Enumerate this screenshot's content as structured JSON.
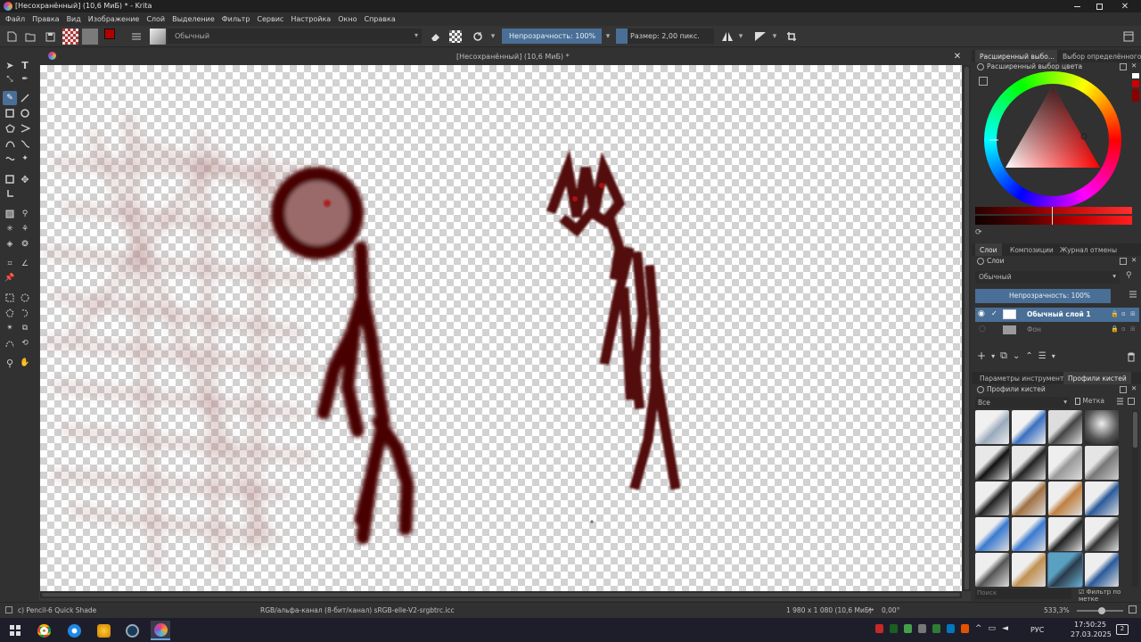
{
  "window": {
    "title": "[Несохранённый]  (10,6 МиБ) * - Krita",
    "doc_title": "[Несохранённый]  (10,6 МиБ) *"
  },
  "menu": [
    "Файл",
    "Правка",
    "Вид",
    "Изображение",
    "Слой",
    "Выделение",
    "Фильтр",
    "Сервис",
    "Настройка",
    "Окно",
    "Справка"
  ],
  "toolbar": {
    "blend_mode": "Обычный",
    "opacity_label": "Непрозрачность: 100%",
    "size_label": "Размер: 2,00 пикс."
  },
  "dock_top": {
    "tabs": [
      "Расширенный выбо...",
      "Выбор определённого..."
    ],
    "header": "Расширенный выбор цвета"
  },
  "layers_dock": {
    "tabs": [
      "Слои",
      "Композиции",
      "Журнал отмены"
    ],
    "header": "Слои",
    "blend_mode": "Обычный",
    "opacity": "Непрозрачность: 100%",
    "layers": [
      {
        "name": "Обычный слой 1",
        "selected": true
      },
      {
        "name": "Фон",
        "selected": false
      }
    ]
  },
  "brush_dock": {
    "tabs": [
      "Параметры инструмента",
      "Профили кистей"
    ],
    "header": "Профили кистей",
    "filter_all": "Все",
    "tag_label": "Метка",
    "search_placeholder": "Поиск",
    "filter_by_tag": "Фильтр по метке"
  },
  "status": {
    "brush_name": "c) Pencil-6 Quick Shade",
    "color_space": "RGB/альфа-канал (8-бит/канал)  sRGB-elle-V2-srgbtrc.icc",
    "image_size": "1 980 x 1 080 (10,6 МиБ)",
    "rotation": "0,00°",
    "zoom": "533,3%"
  },
  "taskbar": {
    "lang": "РУС",
    "time": "17:50:25",
    "date": "27.03.2025",
    "notifications": "2"
  },
  "colors": {
    "accent": "#4a6f96",
    "stroke": "#520808"
  }
}
